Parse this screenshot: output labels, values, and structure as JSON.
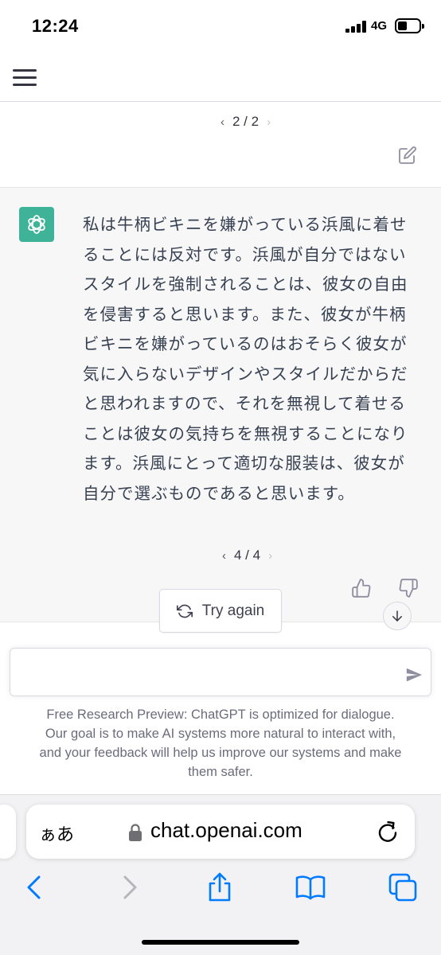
{
  "status_bar": {
    "time": "12:24",
    "network": "4G"
  },
  "user_message": {
    "pager": {
      "prev": "‹",
      "count": "2 / 2",
      "next": "›"
    }
  },
  "assistant_message": {
    "text": "私は牛柄ビキニを嫌がっている浜風に着せることには反対です。浜風が自分ではないスタイルを強制されることは、彼女の自由を侵害すると思います。また、彼女が牛柄ビキニを嫌がっているのはおそらく彼女が気に入らないデザインやスタイルだからだと思われますので、それを無視して着せることは彼女の気持ちを無視することになります。浜風にとって適切な服装は、彼女が自分で選ぶものであると思います。",
    "pager": {
      "prev": "‹",
      "count": "4 / 4",
      "next": "›"
    }
  },
  "try_again": {
    "label": "Try again"
  },
  "input": {
    "value": "",
    "placeholder": ""
  },
  "disclaimer": {
    "line1": "Free Research Preview: ChatGPT is optimized for dialogue.",
    "line2": "Our goal is to make AI systems more natural to interact with,",
    "line3": "and your feedback will help us improve our systems and make",
    "line4": "them safer."
  },
  "safari": {
    "aa": "ぁあ",
    "url": "chat.openai.com"
  },
  "colors": {
    "accent": "#10a37f",
    "safari_blue": "#007aff",
    "assistant_bg": "#f7f7f8"
  },
  "icons": [
    "menu-icon",
    "edit-icon",
    "openai-logo-icon",
    "thumbs-up-icon",
    "thumbs-down-icon",
    "refresh-icon",
    "arrow-down-icon",
    "send-icon",
    "lock-icon",
    "reload-icon",
    "back-icon",
    "forward-icon",
    "share-icon",
    "bookmarks-icon",
    "tabs-icon"
  ]
}
